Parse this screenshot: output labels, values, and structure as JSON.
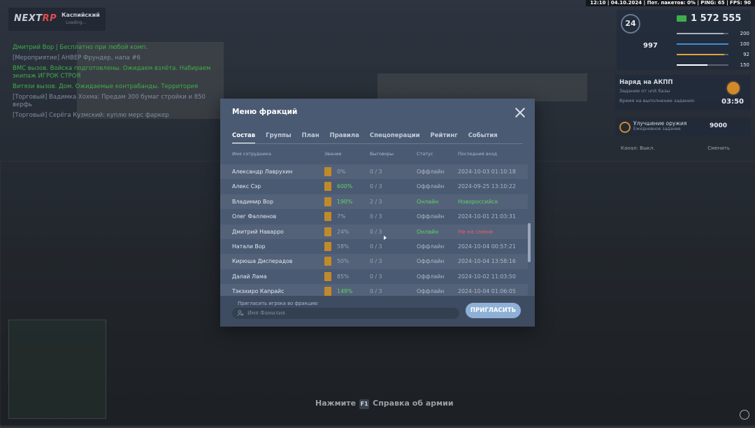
{
  "hud": {
    "topbar": "12:10 | 04.10.2024 | Пот. пакетов: 0% | PING: 65 | FPS: 90",
    "server_brand_a": "NEXT",
    "server_brand_b": "RP",
    "server_name": "Каспийский",
    "server_sub": "Loading...",
    "level": "24",
    "money": "1 572 555",
    "exp": "997",
    "bars": [
      {
        "value": "200",
        "color": "#a9b2bd",
        "fill": 0.9
      },
      {
        "value": "100",
        "color": "#3a8fd6",
        "fill": 1.0
      },
      {
        "value": "92",
        "color": "#e0a23a",
        "fill": 0.92
      },
      {
        "value": "150",
        "color": "#ffffff",
        "fill": 0.6
      }
    ],
    "task_title": "Наряд на АКПП",
    "task_sub": "Задание от unit базы",
    "task_sub2": "Время на выполнение задания:",
    "task_time": "03:50",
    "upgrade_title": "Улучшение оружия",
    "upgrade_sub": "Ежедневное задание",
    "upgrade_value": "9000",
    "radio_left": "Канал: Выкл.",
    "radio_right": "Сменить",
    "hint_prefix": "Нажмите",
    "hint_key": "F1",
    "hint_text": "Справка об армии",
    "chat": [
      {
        "text": "Дмитрий Вор | Бесплатно при любой комп.",
        "green": true
      },
      {
        "text": "[Мероприятие] АНВЕР Фрундер, напа #6",
        "green": false
      },
      {
        "text": "ВМС вызов. Войска подготовлены. Ожидаем взлёта. Набираем экипаж ИГРОК СТРОЯ",
        "green": true
      },
      {
        "text": "Витязи вызов. Дом. Ожидаемые контрабанды. Территория",
        "green": true
      },
      {
        "text": "[Торговый] Вадимка Хохма: Предам 300 бумаг стройки и 850 верфь",
        "green": false
      },
      {
        "text": "[Торговый] Серёга Кузмский: куплю мерс фаркер",
        "green": false
      }
    ]
  },
  "modal": {
    "title": "Меню фракций",
    "tabs": [
      {
        "label": "Состав",
        "active": true
      },
      {
        "label": "Группы",
        "active": false
      },
      {
        "label": "План",
        "active": false
      },
      {
        "label": "Правила",
        "active": false
      },
      {
        "label": "Спецоперации",
        "active": false
      },
      {
        "label": "Рейтинг",
        "active": false
      },
      {
        "label": "События",
        "active": false
      }
    ],
    "columns": {
      "name": "Имя сотрудника",
      "rank": "Звание",
      "warnings": "Выговоры",
      "status": "Статус",
      "last": "Последний вход"
    },
    "rows": [
      {
        "name": "Александр Лаврухин",
        "rank": "0%",
        "warnings": "0 / 3",
        "status": "Оффлайн",
        "last": "2024-10-03 01:10:18",
        "rank_green": false,
        "online": false,
        "last_type": "normal"
      },
      {
        "name": "Алекс Сэр",
        "rank": "600%",
        "warnings": "0 / 3",
        "status": "Оффлайн",
        "last": "2024-09-25 13:10:22",
        "rank_green": true,
        "online": false,
        "last_type": "normal"
      },
      {
        "name": "Владимир Вор",
        "rank": "190%",
        "warnings": "2 / 3",
        "status": "Онлайн",
        "last": "Новороссийск",
        "rank_green": true,
        "online": true,
        "last_type": "on"
      },
      {
        "name": "Олег Фалленов",
        "rank": "7%",
        "warnings": "0 / 3",
        "status": "Оффлайн",
        "last": "2024-10-01 21:03:31",
        "rank_green": false,
        "online": false,
        "last_type": "normal"
      },
      {
        "name": "Дмитрий Наварро",
        "rank": "24%",
        "warnings": "0 / 3",
        "status": "Онлайн",
        "last": "Не на смене",
        "rank_green": false,
        "online": true,
        "last_type": "off"
      },
      {
        "name": "Натали Вор",
        "rank": "58%",
        "warnings": "0 / 3",
        "status": "Оффлайн",
        "last": "2024-10-04 00:57:21",
        "rank_green": false,
        "online": false,
        "last_type": "normal"
      },
      {
        "name": "Кирюша Дисперадов",
        "rank": "50%",
        "warnings": "0 / 3",
        "status": "Оффлайн",
        "last": "2024-10-04 13:58:16",
        "rank_green": false,
        "online": false,
        "last_type": "normal"
      },
      {
        "name": "Далай Лама",
        "rank": "85%",
        "warnings": "0 / 3",
        "status": "Оффлайн",
        "last": "2024-10-02 11:03:50",
        "rank_green": false,
        "online": false,
        "last_type": "normal"
      },
      {
        "name": "Тэкэхиро Капрайс",
        "rank": "149%",
        "warnings": "0 / 3",
        "status": "Оффлайн",
        "last": "2024-10-04 01:06:05",
        "rank_green": true,
        "online": false,
        "last_type": "normal"
      }
    ],
    "invite_label": "Пригласить игрока во фракцию",
    "invite_placeholder": "Имя Фамилия",
    "invite_button": "ПРИГЛАСИТЬ"
  }
}
